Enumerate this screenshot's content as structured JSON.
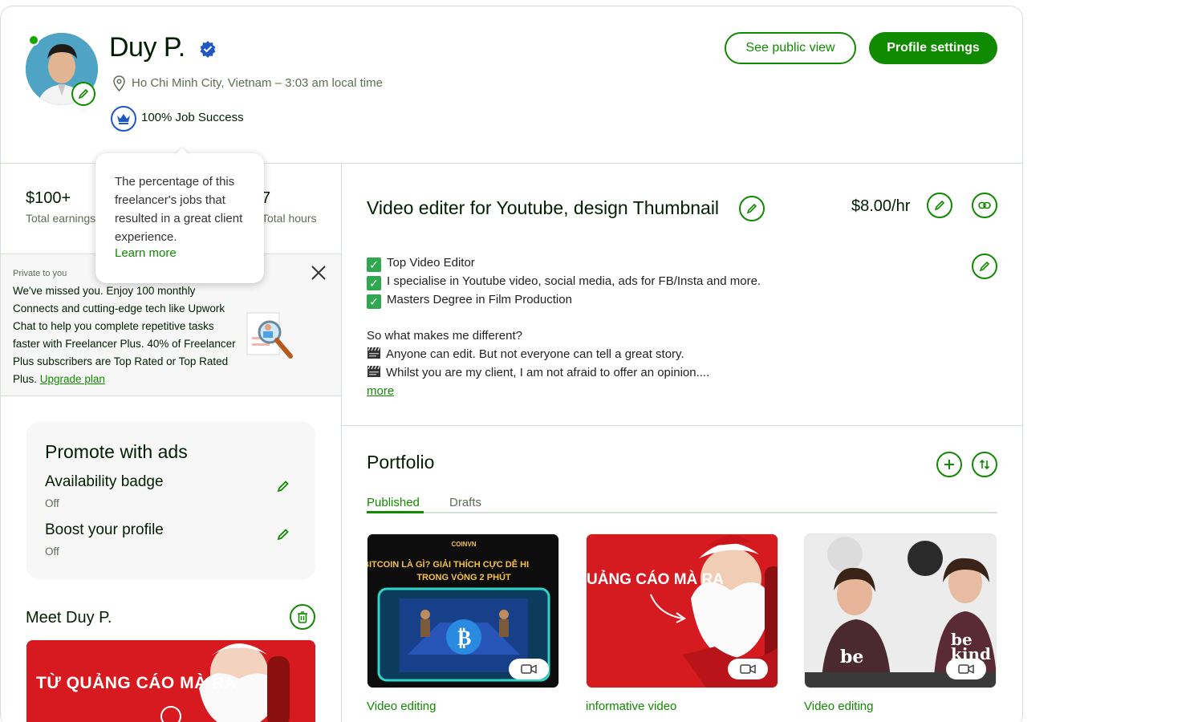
{
  "profile": {
    "name": "Duy P.",
    "location": "Ho Chi Minh City, Vietnam – 3:03 am local time",
    "job_success": "100% Job Success",
    "buttons": {
      "public_view": "See public view",
      "settings": "Profile settings"
    }
  },
  "tooltip": {
    "text": "The percentage of this freelancer's jobs that resulted in a great client experience.",
    "link": "Learn more"
  },
  "stats": {
    "earnings_value": "$100+",
    "earnings_label": "Total earnings",
    "hours_value": "7",
    "hours_label": "Total hours"
  },
  "promo": {
    "tag": "Private to you",
    "text": "We've missed you. Enjoy 100 monthly Connects and cutting-edge tech like Upwork Chat to help you complete repetitive tasks faster with Freelancer Plus. 40% of Freelancer Plus subscribers are Top Rated or Top Rated Plus.",
    "link": "Upgrade plan"
  },
  "ads": {
    "title": "Promote with ads",
    "items": [
      {
        "label": "Availability badge",
        "status": "Off"
      },
      {
        "label": "Boost your profile",
        "status": "Off"
      }
    ]
  },
  "meet": {
    "title": "Meet Duy P.",
    "video_text": "TỪ QUẢNG CÁO MÀ RA"
  },
  "overview": {
    "title": "Video editer for Youtube, design Thumbnail",
    "rate": "$8.00/hr",
    "checks": [
      "Top Video Editor",
      "I specialise in Youtube video, social media, ads for FB/Insta and more.",
      "Masters Degree in Film Production"
    ],
    "question": "So what makes me different?",
    "points": [
      "Anyone can edit. But not everyone can tell a great story.",
      "Whilst you are my client, I am not afraid to offer an opinion...."
    ],
    "more": "more"
  },
  "portfolio": {
    "title": "Portfolio",
    "tabs": [
      "Published",
      "Drafts"
    ],
    "items": [
      {
        "caption": "Video editing",
        "brand": "COINVN",
        "headline1": "BITCOIN LÀ GÌ? GIẢI THÍCH CỰC DỄ HI",
        "headline2": "TRONG VÒNG 2 PHÚT"
      },
      {
        "caption": "informative video",
        "headline1": "UẢNG CÁO MÀ RA"
      },
      {
        "caption": "Video editing",
        "shirt1": "be",
        "shirt2": "be kind"
      }
    ]
  },
  "colors": {
    "brand_green": "#108a00",
    "verified_blue": "#1f57c3",
    "online": "#14a800"
  }
}
